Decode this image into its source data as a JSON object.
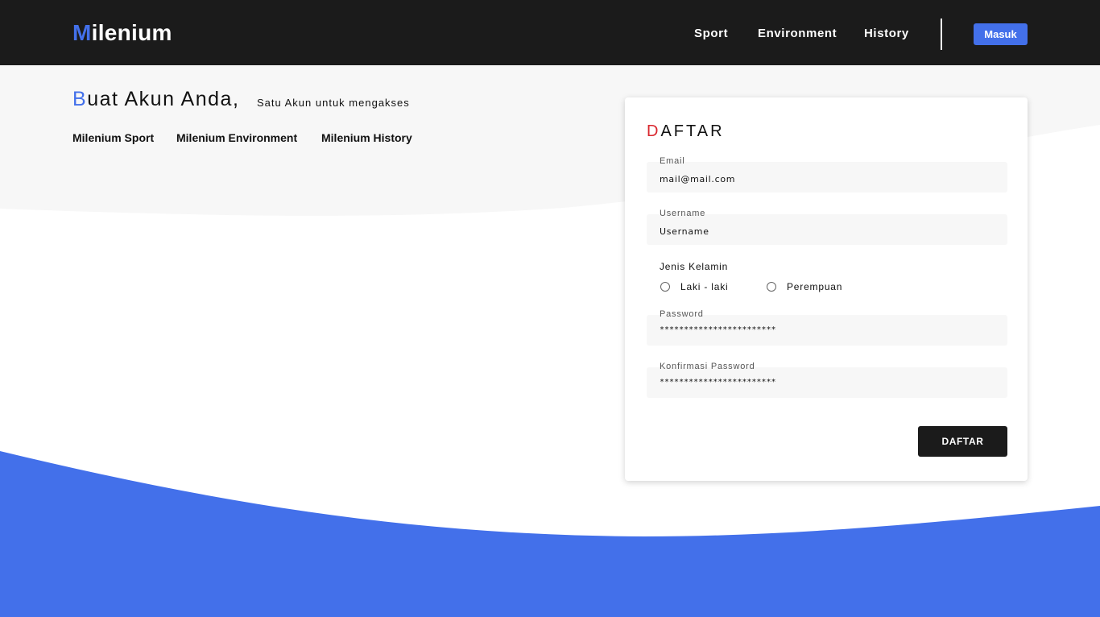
{
  "colors": {
    "accent": "#4370ea",
    "nav_bg": "#1b1b1b",
    "title_red": "#d9272e",
    "light_bg": "#f7f7f7"
  },
  "navbar": {
    "brand_first": "M",
    "brand_rest": "ilenium",
    "links": [
      "Sport",
      "Environment",
      "History"
    ],
    "login_button": "Masuk"
  },
  "hero": {
    "title_first": "B",
    "title_rest": "uat Akun Anda,",
    "subtitle": "Satu Akun untuk mengakses",
    "links": [
      "Milenium Sport",
      "Milenium Environment",
      "Milenium History"
    ]
  },
  "form": {
    "title_first": "D",
    "title_rest": "AFTAR",
    "email": {
      "label": "Email",
      "value": "mail@mail.com"
    },
    "username": {
      "label": "Username",
      "value": "Username"
    },
    "gender": {
      "label": "Jenis Kelamin",
      "options": [
        "Laki - laki",
        "Perempuan"
      ]
    },
    "password": {
      "label": "Password",
      "value": "************************"
    },
    "confirm_password": {
      "label": "Konfirmasi Password",
      "value": "************************"
    },
    "submit_label": "DAFTAR"
  }
}
